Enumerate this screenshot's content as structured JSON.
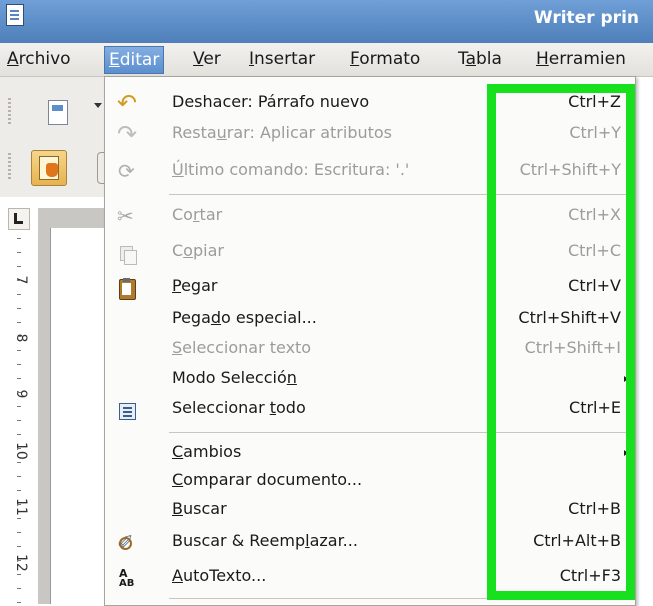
{
  "window": {
    "title": "Writer prin"
  },
  "menubar": {
    "items": [
      {
        "label": "Archivo",
        "key": "A",
        "rest": "rchivo"
      },
      {
        "label": "Editar",
        "key": "E",
        "rest": "ditar"
      },
      {
        "label": "Ver",
        "key": "V",
        "rest": "er"
      },
      {
        "label": "Insertar",
        "key": "I",
        "rest": "nsertar"
      },
      {
        "label": "Formato",
        "key": "F",
        "rest": "ormato"
      },
      {
        "label": "Tabla",
        "pre": "T",
        "key": "a",
        "rest": "bla"
      },
      {
        "label": "Herramien",
        "key": "H",
        "rest": "erramien"
      }
    ]
  },
  "ruler": {
    "numbers": [
      "7",
      "8",
      "9",
      "10",
      "11",
      "12"
    ]
  },
  "edit_menu": {
    "items": [
      {
        "pre": "Deshacer: Párrafo nuevo",
        "key": "",
        "post": "",
        "accel": "Ctrl+Z",
        "enabled": true,
        "icon": "undo-icon"
      },
      {
        "pre": "Resta",
        "key": "u",
        "post": "rar: Aplicar atributos",
        "accel": "Ctrl+Y",
        "enabled": false,
        "icon": "redo-icon"
      },
      {
        "pre": "",
        "key": "Ú",
        "post": "ltimo comando: Escritura: '.'",
        "accel": "Ctrl+Shift+Y",
        "enabled": false,
        "icon": "repeat-icon"
      },
      {
        "pre": "Co",
        "key": "r",
        "post": "tar",
        "accel": "Ctrl+X",
        "enabled": false,
        "icon": "cut-icon"
      },
      {
        "pre": "C",
        "key": "o",
        "post": "piar",
        "accel": "Ctrl+C",
        "enabled": false,
        "icon": "copy-icon"
      },
      {
        "pre": "",
        "key": "P",
        "post": "egar",
        "accel": "Ctrl+V",
        "enabled": true,
        "icon": "paste-icon"
      },
      {
        "pre": "Pega",
        "key": "d",
        "post": "o especial...",
        "accel": "Ctrl+Shift+V",
        "enabled": true,
        "icon": ""
      },
      {
        "pre": "",
        "key": "S",
        "post": "eleccionar texto",
        "accel": "Ctrl+Shift+I",
        "enabled": false,
        "icon": ""
      },
      {
        "pre": "Modo Selecció",
        "key": "n",
        "post": "",
        "accel": "",
        "enabled": true,
        "submenu": true,
        "icon": ""
      },
      {
        "pre": "Seleccionar ",
        "key": "t",
        "post": "odo",
        "accel": "Ctrl+E",
        "enabled": true,
        "icon": "select-all-icon"
      },
      {
        "pre": "",
        "key": "C",
        "post": "ambios",
        "accel": "",
        "enabled": true,
        "submenu": true,
        "icon": ""
      },
      {
        "pre": "",
        "key": "C",
        "post": "omparar documento...",
        "accel": "",
        "enabled": true,
        "icon": ""
      },
      {
        "pre": "",
        "key": "B",
        "post": "uscar",
        "accel": "Ctrl+B",
        "enabled": true,
        "icon": ""
      },
      {
        "pre": "Buscar & Reemp",
        "key": "l",
        "post": "azar...",
        "accel": "Ctrl+Alt+B",
        "enabled": true,
        "icon": "find-replace-icon"
      },
      {
        "pre": "",
        "key": "A",
        "post": "utoTexto...",
        "accel": "Ctrl+F3",
        "enabled": true,
        "icon": "autotext-icon"
      }
    ]
  },
  "icons": {
    "autotext_top": "A",
    "autotext_bottom": "AB"
  },
  "colors": {
    "highlight": "#17e01e",
    "menu_active": "#5c8fcf",
    "title_bar": "#4f7fb9"
  }
}
